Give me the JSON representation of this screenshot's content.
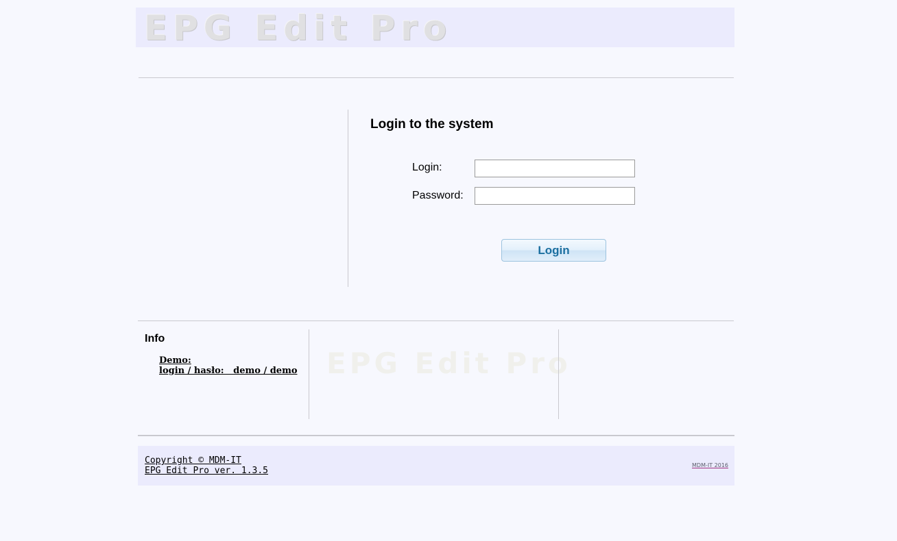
{
  "header": {
    "logo_text": "EPG Edit Pro"
  },
  "login": {
    "title": "Login to the system",
    "login_label": "Login:",
    "login_value": "",
    "password_label": "Password:",
    "password_value": "",
    "submit_label": "Login"
  },
  "info": {
    "title": "Info",
    "demo_label": "Demo:",
    "demo_credentials": "login / hasło:   demo / demo",
    "watermark_text": "EPG Edit Pro"
  },
  "footer": {
    "copyright": "Copyright © MDM-IT",
    "version": "EPG Edit Pro ver. 1.3.5",
    "credit": "MDM-IT 2016"
  },
  "colors": {
    "page_background": "#f7f8fe",
    "banner_background": "#ebebfd",
    "divider": "#c9c9cf",
    "button_text": "#1c6fa0"
  }
}
